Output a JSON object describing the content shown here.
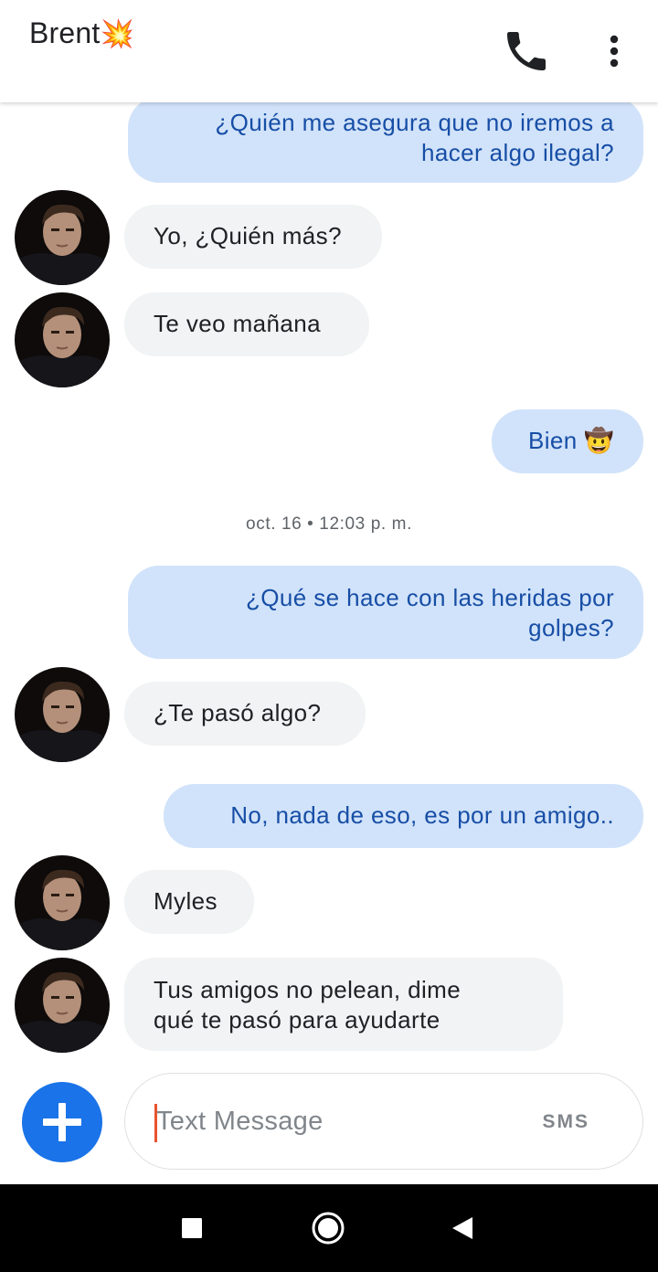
{
  "header": {
    "contact_name": "Brent",
    "contact_emoji": "💥"
  },
  "messages": [
    {
      "direction": "out",
      "lines": [
        "¿Quién me asegura que no iremos a",
        "hacer algo ilegal?"
      ]
    },
    {
      "direction": "in",
      "text": "Yo, ¿Quién más?"
    },
    {
      "direction": "in",
      "text": "Te veo mañana"
    },
    {
      "direction": "out",
      "text": "Bien",
      "emoji": "🤠"
    },
    {
      "direction": "out",
      "lines": [
        "¿Qué se hace con las heridas por",
        "golpes?"
      ]
    },
    {
      "direction": "in",
      "text": "¿Te pasó algo?"
    },
    {
      "direction": "out",
      "text": "No, nada de eso, es por un amigo.."
    },
    {
      "direction": "in",
      "text": "Myles"
    },
    {
      "direction": "in",
      "lines": [
        "Tus amigos no pelean, dime",
        "qué te pasó para ayudarte"
      ]
    }
  ],
  "timestamp": "oct. 16 • 12:03 p. m.",
  "compose": {
    "placeholder": "Text Message",
    "mode_label": "SMS"
  },
  "colors": {
    "outgoing_bubble": "#d1e3fa",
    "outgoing_text": "#174ea6",
    "incoming_bubble": "#f1f3f4",
    "accent": "#1a73e8"
  },
  "icons": {
    "call": "phone-icon",
    "menu": "more-vert-icon",
    "add": "plus-icon",
    "nav_recent": "square-icon",
    "nav_home": "circle-icon",
    "nav_back": "triangle-back-icon"
  }
}
